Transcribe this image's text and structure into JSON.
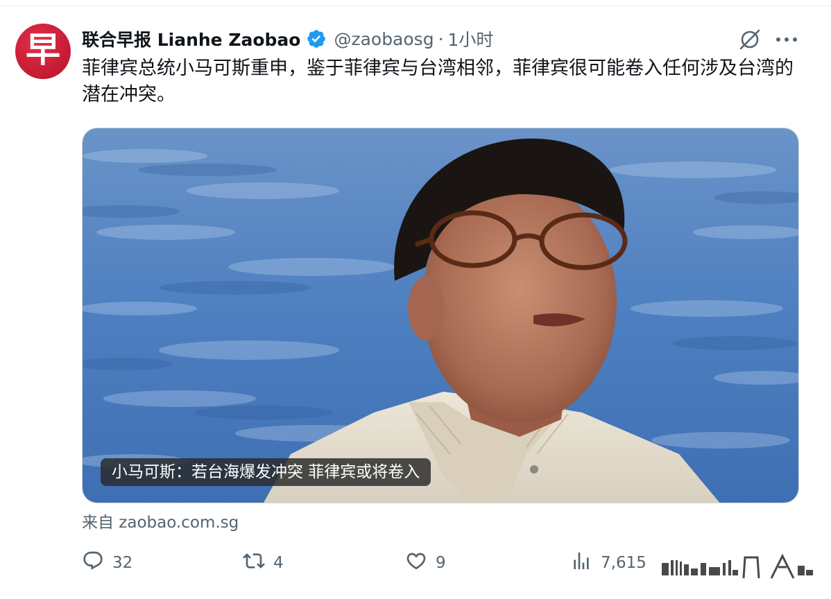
{
  "tweet": {
    "avatar_glyph": "早",
    "display_name": "联合早报 Lianhe Zaobao",
    "handle": "@zaobaosg",
    "separator": "·",
    "time": "1小时",
    "text": "菲律宾总统小马可斯重申，鉴于菲律宾与台湾相邻，菲律宾很可能卷入任何涉及台湾的潜在冲突。",
    "media_caption": "小马可斯：若台海爆发冲突 菲律宾或将卷入",
    "source_label": "来自 zaobao.com.sg"
  },
  "actions": {
    "replies": "32",
    "reposts": "4",
    "likes": "9",
    "views": "7,615"
  },
  "icons": {
    "verified": "verified-badge-icon",
    "grok": "grok-icon",
    "more": "more-icon",
    "reply": "reply-icon",
    "repost": "repost-icon",
    "like": "like-icon",
    "views": "views-icon"
  },
  "colors": {
    "avatar_red": "#c81d35",
    "verified_blue": "#1d9bf0",
    "secondary_text": "#536471"
  }
}
